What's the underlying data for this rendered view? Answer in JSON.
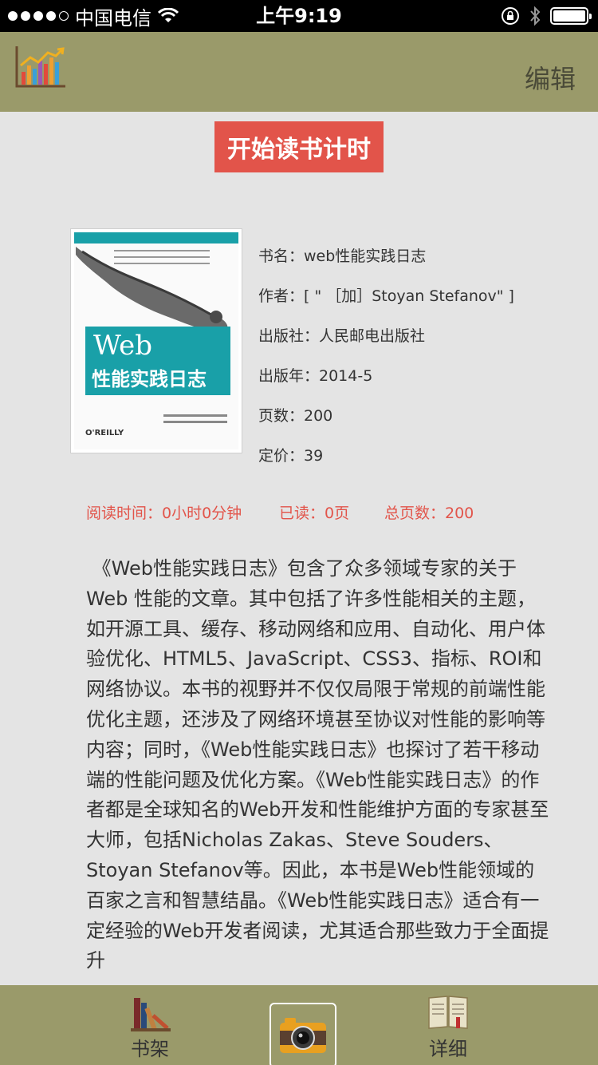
{
  "status_bar": {
    "carrier": "中国电信",
    "time": "上午9:19"
  },
  "nav": {
    "edit_label": "编辑",
    "left_icon": "chart-icon"
  },
  "start_button_label": "开始读书计时",
  "book": {
    "cover_title_en": "Web",
    "cover_title_cn": "性能实践日志",
    "cover_publisher_logo": "O'REILLY",
    "title_line": "书名：web性能实践日志",
    "author_line": "作者：[ \" ［加］Stoyan Stefanov\" ]",
    "publisher_line": "出版社：人民邮电出版社",
    "year_line": "出版年：2014-5",
    "pages_line": "页数：200",
    "price_line": "定价：39"
  },
  "reading_stats": {
    "time": "阅读时间：0小时0分钟",
    "read": "已读：0页",
    "total": "总页数：200"
  },
  "description": " 《Web性能实践日志》包含了众多领域专家的关于 Web 性能的文章。其中包括了许多性能相关的主题，如开源工具、缓存、移动网络和应用、自动化、用户体验优化、HTML5、JavaScript、CSS3、指标、ROI和网络协议。本书的视野并不仅仅局限于常规的前端性能优化主题，还涉及了网络环境甚至协议对性能的影响等内容；同时，《Web性能实践日志》也探讨了若干移动端的性能问题及优化方案。《Web性能实践日志》的作者都是全球知名的Web开发和性能维护方面的专家甚至大师，包括Nicholas Zakas、Steve Souders、Stoyan Stefanov等。因此，本书是Web性能领域的百家之言和智慧结晶。《Web性能实践日志》适合有一定经验的Web开发者阅读，尤其适合那些致力于全面提升",
  "tab_bar": {
    "shelf_label": "书架",
    "detail_label": "详细",
    "icons": [
      "bookshelf-icon",
      "camera-icon",
      "open-book-icon"
    ]
  },
  "colors": {
    "bar": "#9a9a6a",
    "accent": "#e2544a",
    "background": "#e4e4e4"
  }
}
